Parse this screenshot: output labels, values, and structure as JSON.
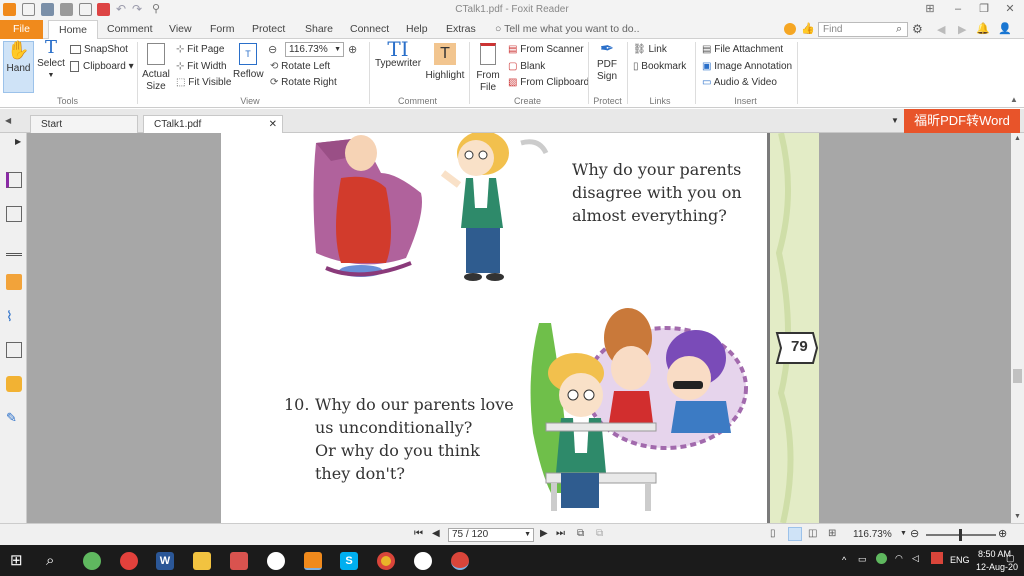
{
  "window": {
    "title": "CTalk1.pdf - Foxit Reader"
  },
  "menu": {
    "tabs": [
      "File",
      "Home",
      "Comment",
      "View",
      "Form",
      "Protect",
      "Share",
      "Connect",
      "Help",
      "Extras"
    ],
    "tell_me": "Tell me what you want to do..",
    "find_placeholder": "Find"
  },
  "ribbon": {
    "tools": {
      "hand": "Hand",
      "select": "Select",
      "snapshot": "SnapShot",
      "clipboard": "Clipboard",
      "group": "Tools"
    },
    "view": {
      "actual_size_1": "Actual",
      "actual_size_2": "Size",
      "fit_page": "Fit Page",
      "fit_width": "Fit Width",
      "fit_visible": "Fit Visible",
      "reflow": "Reflow",
      "zoom": "116.73%",
      "rotate_left": "Rotate Left",
      "rotate_right": "Rotate Right",
      "group": "View"
    },
    "comment": {
      "typewriter": "Typewriter",
      "highlight": "Highlight",
      "group": "Comment"
    },
    "create": {
      "from_file_1": "From",
      "from_file_2": "File",
      "from_scanner": "From Scanner",
      "blank": "Blank",
      "from_clipboard": "From Clipboard",
      "group": "Create"
    },
    "protect": {
      "pdf_sign_1": "PDF",
      "pdf_sign_2": "Sign",
      "group": "Protect"
    },
    "links": {
      "link": "Link",
      "bookmark": "Bookmark",
      "group": "Links"
    },
    "insert": {
      "file_attachment": "File Attachment",
      "image_annotation": "Image Annotation",
      "audio_video": "Audio & Video",
      "group": "Insert"
    }
  },
  "doc_tabs": {
    "start": "Start",
    "current": "CTalk1.pdf"
  },
  "promo": "福昕PDF转Word",
  "page_content": {
    "q9_lines": [
      "Why do your parents",
      "disagree with you on",
      "almost everything?"
    ],
    "q10_number": "10.",
    "q10_lines": [
      "Why do our parents love",
      "us unconditionally?",
      "Or why do you think",
      "they don't?"
    ],
    "page_number": "79"
  },
  "status": {
    "page": "75 / 120",
    "zoom": "116.73%"
  },
  "taskbar": {
    "lang": "ENG",
    "time": "8:50 AM",
    "date": "12-Aug-20"
  },
  "colors": {
    "accent": "#f08a1c",
    "promo": "#e8542a"
  }
}
